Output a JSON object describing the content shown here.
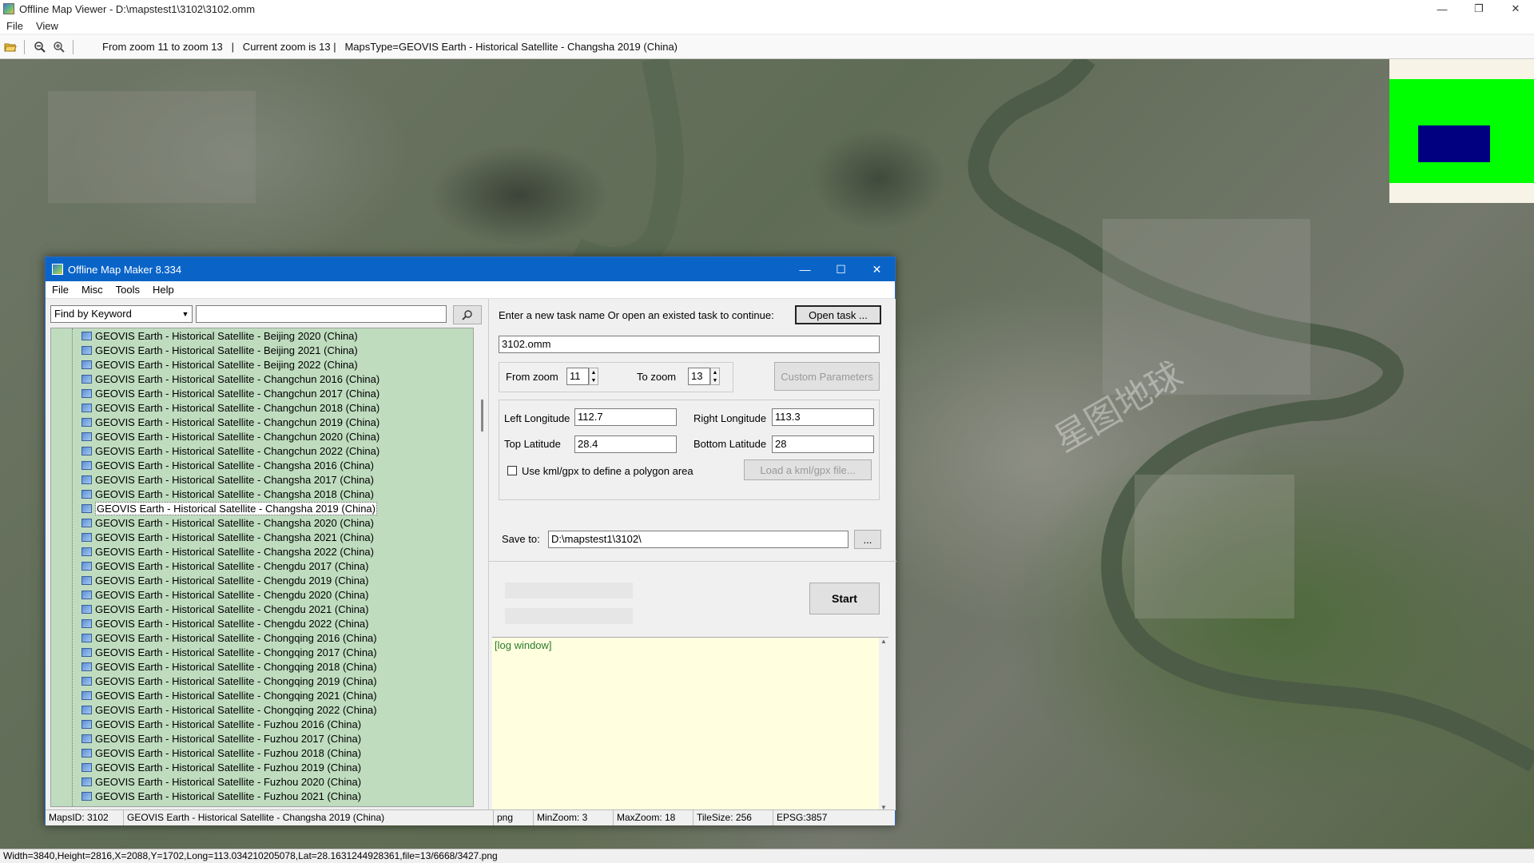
{
  "window": {
    "title": "Offline Map Viewer - D:\\mapstest1\\3102\\3102.omm",
    "controls": {
      "minimize": "—",
      "restore": "❐",
      "close": "✕"
    }
  },
  "menu": [
    "File",
    "View"
  ],
  "toolbar": {
    "status": "From zoom 11 to zoom 13   |   Current zoom is 13 |   MapsType=GEOVIS Earth - Historical Satellite - Changsha 2019 (China)"
  },
  "map": {
    "watermark": "星图地球"
  },
  "bottom_status": "Width=3840,Height=2816,X=2088,Y=1702,Long=113.034210205078,Lat=28.1631244928361,file=13/6668/3427.png",
  "dialog": {
    "title": "Offline Map Maker 8.334",
    "controls": {
      "minimize": "—",
      "maximize": "☐",
      "close": "✕"
    },
    "menu": [
      "File",
      "Misc",
      "Tools",
      "Help"
    ],
    "find_mode": "Find by Keyword",
    "keyword": "",
    "maps": [
      "GEOVIS Earth - Historical Satellite - Beijing 2020 (China)",
      "GEOVIS Earth - Historical Satellite - Beijing 2021 (China)",
      "GEOVIS Earth - Historical Satellite - Beijing 2022 (China)",
      "GEOVIS Earth - Historical Satellite - Changchun 2016 (China)",
      "GEOVIS Earth - Historical Satellite - Changchun 2017 (China)",
      "GEOVIS Earth - Historical Satellite - Changchun 2018 (China)",
      "GEOVIS Earth - Historical Satellite - Changchun 2019 (China)",
      "GEOVIS Earth - Historical Satellite - Changchun 2020 (China)",
      "GEOVIS Earth - Historical Satellite - Changchun 2022 (China)",
      "GEOVIS Earth - Historical Satellite - Changsha 2016 (China)",
      "GEOVIS Earth - Historical Satellite - Changsha 2017 (China)",
      "GEOVIS Earth - Historical Satellite - Changsha 2018 (China)",
      "GEOVIS Earth - Historical Satellite - Changsha 2019 (China)",
      "GEOVIS Earth - Historical Satellite - Changsha 2020 (China)",
      "GEOVIS Earth - Historical Satellite - Changsha 2021 (China)",
      "GEOVIS Earth - Historical Satellite - Changsha 2022 (China)",
      "GEOVIS Earth - Historical Satellite - Chengdu 2017 (China)",
      "GEOVIS Earth - Historical Satellite - Chengdu 2019 (China)",
      "GEOVIS Earth - Historical Satellite - Chengdu 2020 (China)",
      "GEOVIS Earth - Historical Satellite - Chengdu 2021 (China)",
      "GEOVIS Earth - Historical Satellite - Chengdu 2022 (China)",
      "GEOVIS Earth - Historical Satellite - Chongqing 2016 (China)",
      "GEOVIS Earth - Historical Satellite - Chongqing 2017 (China)",
      "GEOVIS Earth - Historical Satellite - Chongqing 2018 (China)",
      "GEOVIS Earth - Historical Satellite - Chongqing 2019 (China)",
      "GEOVIS Earth - Historical Satellite - Chongqing 2021 (China)",
      "GEOVIS Earth - Historical Satellite - Chongqing 2022 (China)",
      "GEOVIS Earth - Historical Satellite - Fuzhou 2016 (China)",
      "GEOVIS Earth - Historical Satellite - Fuzhou 2017 (China)",
      "GEOVIS Earth - Historical Satellite - Fuzhou 2018 (China)",
      "GEOVIS Earth - Historical Satellite - Fuzhou 2019 (China)",
      "GEOVIS Earth - Historical Satellite - Fuzhou 2020 (China)",
      "GEOVIS Earth - Historical Satellite - Fuzhou 2021 (China)"
    ],
    "selected_map": "GEOVIS Earth - Historical Satellite - Changsha 2019 (China)",
    "task_prompt": "Enter a new task name Or open an existed task to continue:",
    "open_task_label": "Open task ...",
    "task_name": "3102.omm",
    "from_zoom_label": "From zoom",
    "from_zoom": "11",
    "to_zoom_label": "To zoom",
    "to_zoom": "13",
    "custom_params_label": "Custom Parameters",
    "left_lon_label": "Left Longitude",
    "left_lon": "112.7",
    "right_lon_label": "Right Longitude",
    "right_lon": "113.3",
    "top_lat_label": "Top Latitude",
    "top_lat": "28.4",
    "bottom_lat_label": "Bottom Latitude",
    "bottom_lat": "28",
    "kml_label": "Use kml/gpx to define a polygon area",
    "load_kml_label": "Load a kml/gpx file...",
    "save_to_label": "Save to:",
    "save_to": "D:\\mapstest1\\3102\\",
    "browse_label": "...",
    "start_label": "Start",
    "log_text": "[log window]",
    "status": {
      "maps_id": "MapsID: 3102",
      "map_name": "GEOVIS Earth - Historical Satellite - Changsha 2019 (China)",
      "format": "png",
      "min_zoom": "MinZoom: 3",
      "max_zoom": "MaxZoom: 18",
      "tile_size": "TileSize: 256",
      "epsg": "EPSG:3857"
    }
  },
  "colors": {
    "dialog_title": "#0a64c8",
    "list_bg": "#bfdcbf",
    "log_bg": "#ffffe0",
    "minimap_green": "#00ff00",
    "minimap_blue": "#000080"
  }
}
